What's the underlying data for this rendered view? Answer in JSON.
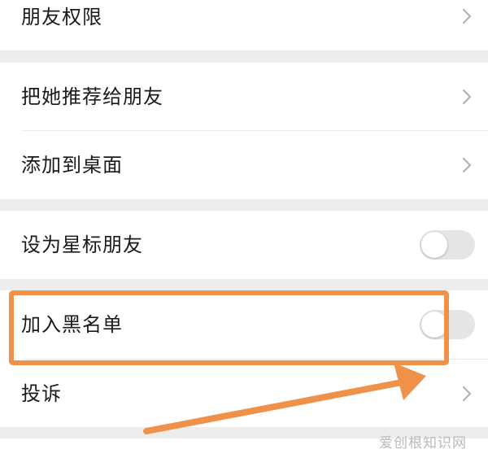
{
  "settings": {
    "items": [
      {
        "label": "朋友权限",
        "control": "chevron"
      },
      {
        "label": "把她推荐给朋友",
        "control": "chevron"
      },
      {
        "label": "添加到桌面",
        "control": "chevron"
      },
      {
        "label": "设为星标朋友",
        "control": "toggle",
        "on": false
      },
      {
        "label": "加入黑名单",
        "control": "toggle",
        "on": false,
        "highlighted": true
      },
      {
        "label": "投诉",
        "control": "chevron"
      }
    ]
  },
  "annotation": {
    "highlight_color": "#f0914a",
    "arrow_color": "#f0914a",
    "target": "加入黑名单"
  },
  "watermark": {
    "text": "爱创根知识网"
  },
  "colors": {
    "background": "#ededed",
    "card": "#ffffff",
    "text": "#1a1a1a",
    "toggle_off": "#e5e5e5",
    "chevron": "#b2b2b2"
  },
  "icons": {
    "chevron": "chevron-right-icon"
  }
}
